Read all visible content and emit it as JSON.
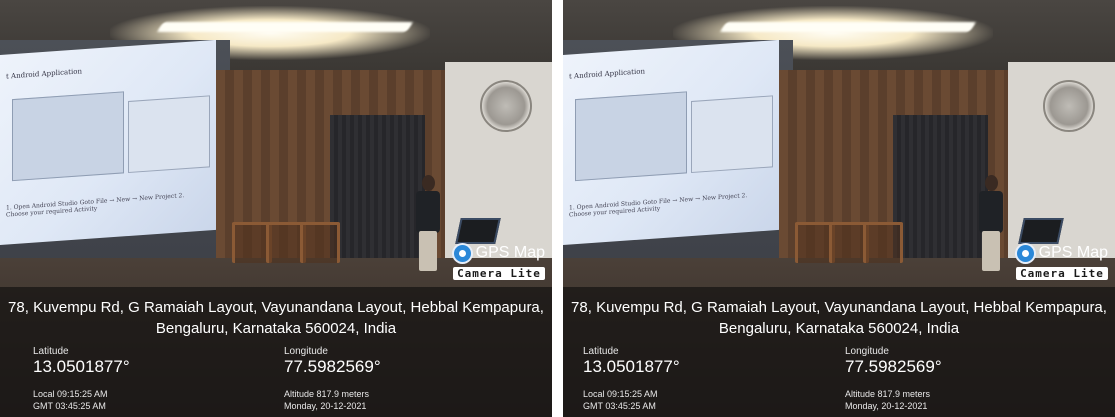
{
  "photos": [
    {
      "slide": {
        "title": "t Android Application",
        "footer": "1.  Open Android Studio Goto File → New → New Project      2.  Choose your required Activity"
      },
      "logo": {
        "icon": "map-pin-icon",
        "title": "GPS Map",
        "subtitle": "Camera Lite"
      },
      "address_line1": "78, Kuvempu Rd, G Ramaiah Layout, Vayunandana Layout, Hebbal Kempapura,",
      "address_line2": "Bengaluru, Karnataka 560024, India",
      "latitude_label": "Latitude",
      "latitude_value": "13.0501877°",
      "longitude_label": "Longitude",
      "longitude_value": "77.5982569°",
      "local_time": "Local 09:15:25 AM",
      "gmt_time": "GMT 03:45:25 AM",
      "altitude": "Altitude 817.9 meters",
      "date": "Monday, 20-12-2021"
    },
    {
      "slide": {
        "title": "t Android Application",
        "footer": "1.  Open Android Studio Goto File → New → New Project      2.  Choose your required Activity"
      },
      "logo": {
        "icon": "map-pin-icon",
        "title": "GPS Map",
        "subtitle": "Camera Lite"
      },
      "address_line1": "78, Kuvempu Rd, G Ramaiah Layout, Vayunandana Layout, Hebbal Kempapura,",
      "address_line2": "Bengaluru, Karnataka 560024, India",
      "latitude_label": "Latitude",
      "latitude_value": "13.0501877°",
      "longitude_label": "Longitude",
      "longitude_value": "77.5982569°",
      "local_time": "Local 09:15:25 AM",
      "gmt_time": "GMT 03:45:25 AM",
      "altitude": "Altitude 817.9 meters",
      "date": "Monday, 20-12-2021"
    }
  ],
  "colors": {
    "overlay": "#181615",
    "pin": "#2b88d8",
    "wood": "#6a4a33"
  }
}
